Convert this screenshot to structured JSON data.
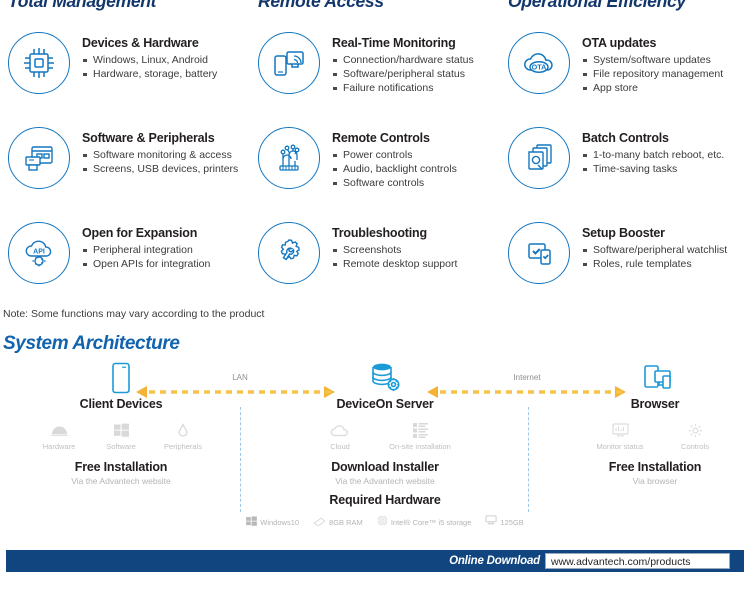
{
  "columns": [
    {
      "header": "Total Management"
    },
    {
      "header": "Remote Access"
    },
    {
      "header": "Operational Efficiency"
    }
  ],
  "features": [
    [
      {
        "icon": "chip-icon",
        "title": "Devices & Hardware",
        "bullets": [
          "Windows, Linux, Android",
          "Hardware, storage, battery"
        ]
      },
      {
        "icon": "software-peripherals-icon",
        "title": "Software & Peripherals",
        "bullets": [
          "Software monitoring & access",
          "Screens, USB devices, printers"
        ]
      },
      {
        "icon": "api-cloud-icon",
        "title": "Open for Expansion",
        "bullets": [
          "Peripheral integration",
          "Open APIs for integration"
        ]
      }
    ],
    [
      {
        "icon": "realtime-monitoring-icon",
        "title": "Real-Time Monitoring",
        "bullets": [
          "Connection/hardware status",
          "Software/peripheral status",
          "Failure notifications"
        ]
      },
      {
        "icon": "remote-controls-icon",
        "title": "Remote Controls",
        "bullets": [
          "Power controls",
          "Audio, backlight controls",
          "Software controls"
        ]
      },
      {
        "icon": "troubleshooting-gear-wrench-icon",
        "title": "Troubleshooting",
        "bullets": [
          "Screenshots",
          "Remote desktop support"
        ]
      }
    ],
    [
      {
        "icon": "ota-cloud-icon",
        "title": "OTA updates",
        "bullets": [
          "System/software updates",
          "File repository management",
          "App store"
        ]
      },
      {
        "icon": "batch-controls-icon",
        "title": "Batch Controls",
        "bullets": [
          "1-to-many batch reboot, etc.",
          "Time-saving tasks"
        ]
      },
      {
        "icon": "setup-booster-icon",
        "title": "Setup Booster",
        "bullets": [
          "Software/peripheral watchlist",
          "Roles, rule templates"
        ]
      }
    ]
  ],
  "note": "Note: Some functions may vary according to the product",
  "architecture": {
    "title": "System Architecture",
    "nodes": [
      {
        "icon": "mobile-device-icon",
        "name": "Client Devices",
        "sub_items": [
          {
            "icon": "android-icon",
            "label": "Hardware"
          },
          {
            "icon": "windows-icon",
            "label": "Software"
          },
          {
            "icon": "peripherals-icon",
            "label": "Peripherals"
          }
        ],
        "block_title": "Free Installation",
        "block_sub": "Via the Advantech website"
      },
      {
        "icon": "server-database-gear-icon",
        "name": "DeviceOn Server",
        "sub_items": [
          {
            "icon": "cloud-icon",
            "label": "Cloud"
          },
          {
            "icon": "onsite-server-icon",
            "label": "On-site installation"
          }
        ],
        "block_title": "Download Installer",
        "block_sub": "Via the Advantech website",
        "hardware_title": "Required Hardware",
        "hardware": [
          {
            "icon": "windows-icon",
            "label": "Windows10"
          },
          {
            "icon": "ram-icon",
            "label": "8GB RAM"
          },
          {
            "icon": "cpu-icon",
            "label": "Intel® Core™ i5 storage"
          },
          {
            "icon": "storage-icon",
            "label": "125GB"
          }
        ]
      },
      {
        "icon": "browser-devices-icon",
        "name": "Browser",
        "sub_items": [
          {
            "icon": "monitor-status-icon",
            "label": "Monitor status"
          },
          {
            "icon": "controls-gear-icon",
            "label": "Controls"
          }
        ],
        "block_title": "Free Installation",
        "block_sub": "Via browser"
      }
    ],
    "links": [
      {
        "label": "LAN",
        "icon": "double-arrow-dashed-icon"
      },
      {
        "label": "Internet",
        "icon": "double-arrow-dashed-icon"
      }
    ]
  },
  "footer": {
    "label": "Online Download",
    "url": "www.advantech.com/products"
  },
  "colors": {
    "brand_blue": "#1477c0",
    "header_navy": "#13366b",
    "title_blue": "#1263ae",
    "arrow_orange": "#f7b733",
    "footer_bg": "#10457f"
  }
}
